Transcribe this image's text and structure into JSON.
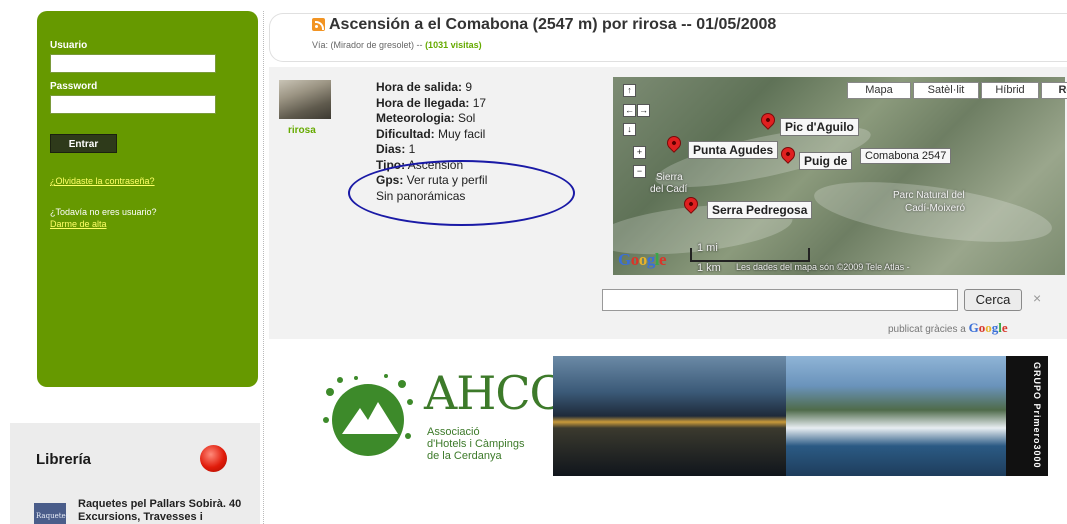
{
  "login": {
    "user_label": "Usuario",
    "password_label": "Password",
    "enter_button": "Entrar",
    "forgot_link": "¿Olvidaste la contraseña?",
    "not_user_text": "¿Todavía no eres usuario?",
    "signup_link": "Darme de alta"
  },
  "libreria": {
    "title": "Librería",
    "book_thumb": "Raquetes",
    "book_title": "Raquetes pel Pallars Sobirà. 40 Excursions, Travesses i"
  },
  "route": {
    "title": "Ascensión a el Comabona (2547 m) por rirosa -- 01/05/2008",
    "via_prefix": "Vía: (Mirador de gresolet) --",
    "visits": "(1031 visitas)",
    "author": "rirosa"
  },
  "details": {
    "salida_label": "Hora de salida:",
    "salida_value": " 9",
    "llegada_label": "Hora de llegada:",
    "llegada_value": " 17",
    "meteo_label": "Meteorologia:",
    "meteo_value": " Sol",
    "dificultad_label": "Dificultad:",
    "dificultad_value": " Muy facil",
    "dias_label": "Dias:",
    "dias_value": " 1",
    "tipo_label": "Tipo:",
    "tipo_value": " Ascensión",
    "gps_label": "Gps:",
    "gps_value": " Ver ruta y perfil",
    "panoramicas": "Sin panorámicas"
  },
  "map": {
    "tabs": [
      "Mapa",
      "Satèl·lit",
      "Híbrid",
      "Relleu"
    ],
    "active_tab": "Relleu",
    "nav": [
      "↑",
      "←",
      "→",
      "↓",
      "+",
      "−"
    ],
    "labels": {
      "pic": "Pic d'Aguilo",
      "punta": "Punta Agudes",
      "puig": "Puig de",
      "comabona": "Comabona 2547",
      "serra": "Serra Pedregosa"
    },
    "texts": {
      "sierra": "Sierra",
      "del_cadi": "del Cadí",
      "parc1": "Parc Natural del",
      "parc2": "Cadí-Moixeró"
    },
    "scale_mi": "1 mi",
    "scale_km": "1 km",
    "copyright": "Les dades del mapa són ©2009 Tele Atlas -",
    "google": "Google"
  },
  "search": {
    "value": "",
    "button": "Cerca",
    "close": "×",
    "publicat": "publicat gràcies a",
    "google": "Google"
  },
  "banner": {
    "ahcc": "AHCC",
    "sub1": "Associació",
    "sub2": "d'Hotels i Càmpings",
    "sub3": "de la Cerdanya",
    "grupo": "GRUPO Primero3000"
  },
  "colors": {
    "login_green": "#669900",
    "link_yellow": "#ffff66",
    "visits_green": "#66aa00",
    "ellipse_blue": "#1a1aa6",
    "pin_red": "#e02020"
  }
}
